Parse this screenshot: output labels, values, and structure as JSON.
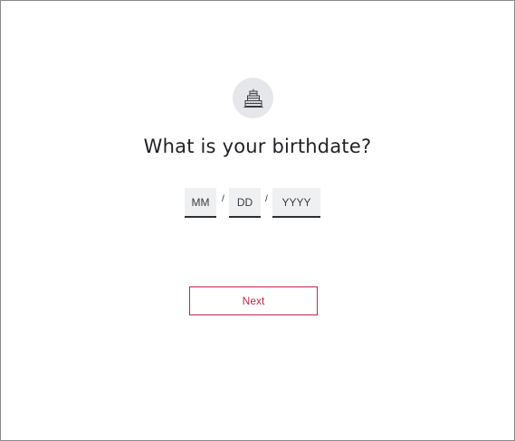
{
  "header": {
    "icon": "birthday-cake-icon",
    "title": "What is your birthdate?"
  },
  "birthdate": {
    "month": {
      "value": "",
      "placeholder": "MM"
    },
    "day": {
      "value": "",
      "placeholder": "DD"
    },
    "year": {
      "value": "",
      "placeholder": "YYYY"
    },
    "separator": "/"
  },
  "actions": {
    "next_label": "Next"
  },
  "colors": {
    "accent": "#c7254e",
    "icon_badge": "#e6e7ea",
    "field_background": "#eef0f2",
    "text": "#1f2125"
  }
}
